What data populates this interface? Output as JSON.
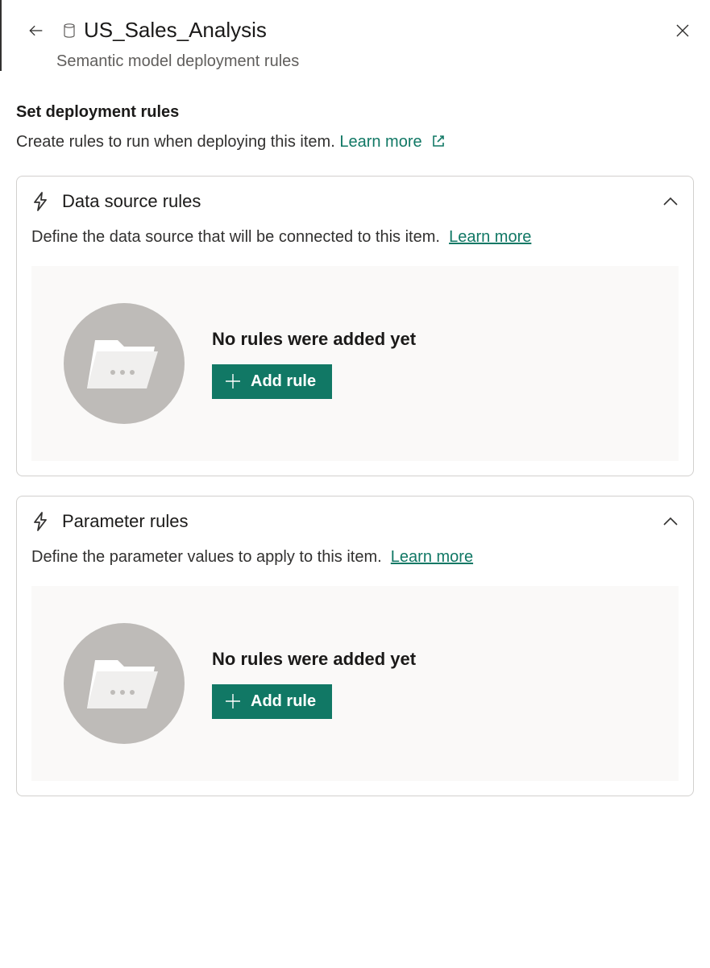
{
  "header": {
    "title": "US_Sales_Analysis",
    "subtitle": "Semantic model deployment rules"
  },
  "intro": {
    "heading": "Set deployment rules",
    "description": "Create rules to run when deploying this item.",
    "learn_more": "Learn more"
  },
  "colors": {
    "accent": "#117865"
  },
  "cards": {
    "data_source": {
      "title": "Data source rules",
      "description": "Define the data source that will be connected to this item.",
      "learn_more": "Learn more",
      "empty_title": "No rules were added yet",
      "add_label": "Add rule"
    },
    "parameter": {
      "title": "Parameter rules",
      "description": "Define the parameter values to apply to this item.",
      "learn_more": "Learn more",
      "empty_title": "No rules were added yet",
      "add_label": "Add rule"
    }
  }
}
